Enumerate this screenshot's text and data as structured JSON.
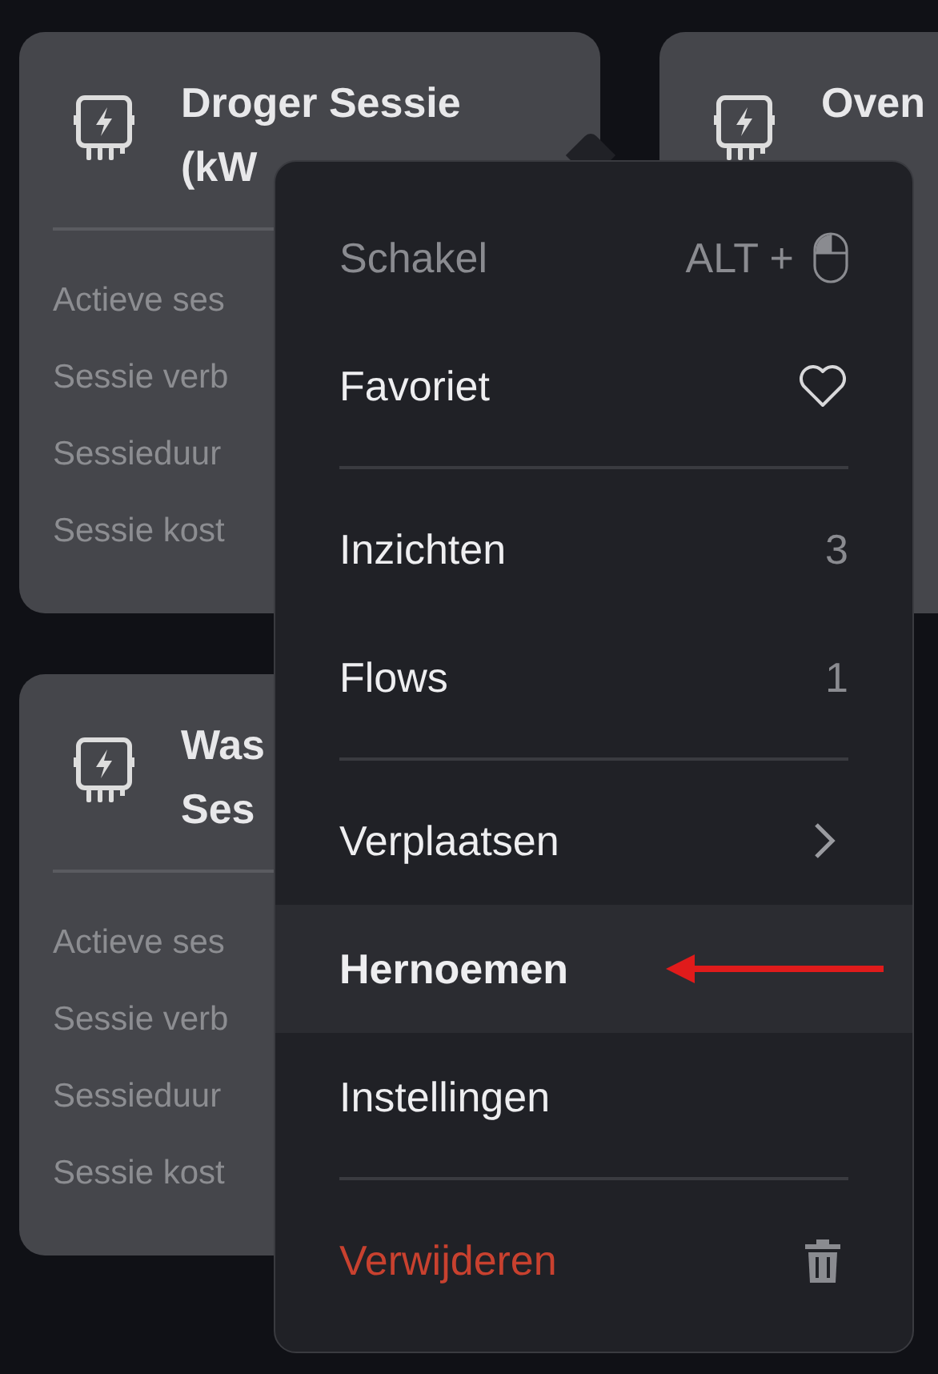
{
  "cards": [
    {
      "title_lines": [
        "Droger Sessie",
        "(kW"
      ],
      "rows": [
        "Actieve ses",
        "Sessie verb",
        "Sessieduur",
        "Sessie kost"
      ]
    },
    {
      "title_lines": [
        "Oven"
      ]
    },
    {
      "title_lines": [
        "Was",
        "Ses"
      ],
      "rows": [
        "Actieve ses",
        "Sessie verb",
        "Sessieduur",
        "Sessie kost"
      ]
    }
  ],
  "menu": {
    "items": [
      {
        "kind": "shortcut",
        "label": "Schakel",
        "shortcut": "ALT +",
        "selected": false
      },
      {
        "kind": "favorite",
        "label": "Favoriet",
        "selected": false
      },
      {
        "kind": "divider"
      },
      {
        "kind": "count",
        "label": "Inzichten",
        "count": "3",
        "selected": false
      },
      {
        "kind": "count",
        "label": "Flows",
        "count": "1",
        "selected": false
      },
      {
        "kind": "divider"
      },
      {
        "kind": "submenu",
        "label": "Verplaatsen",
        "selected": false
      },
      {
        "kind": "action",
        "label": "Hernoemen",
        "selected": true,
        "pointed": true
      },
      {
        "kind": "action",
        "label": "Instellingen",
        "selected": false
      },
      {
        "kind": "divider"
      },
      {
        "kind": "danger",
        "label": "Verwijderen",
        "selected": false
      }
    ]
  }
}
